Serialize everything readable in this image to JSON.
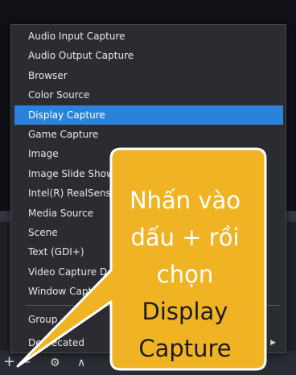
{
  "menu": {
    "items": [
      {
        "label": "Audio Input Capture"
      },
      {
        "label": "Audio Output Capture"
      },
      {
        "label": "Browser"
      },
      {
        "label": "Color Source"
      },
      {
        "label": "Display Capture",
        "selected": true
      },
      {
        "label": "Game Capture"
      },
      {
        "label": "Image"
      },
      {
        "label": "Image Slide Show"
      },
      {
        "label": "Intel(R) RealSense"
      },
      {
        "label": "Media Source"
      },
      {
        "label": "Scene"
      },
      {
        "label": "Text (GDI+)"
      },
      {
        "label": "Video Capture Device"
      },
      {
        "label": "Window Capture"
      },
      {
        "label": "Group"
      },
      {
        "label": "Deprecated",
        "has_submenu": true
      }
    ]
  },
  "toolbar": {
    "add_label": "+",
    "remove_label": "—",
    "up_label": "∧"
  },
  "callout": {
    "line1": "Nhấn vào",
    "line2": "dấu + rồi",
    "line3": "chọn",
    "line4": "Display",
    "line5": "Capture",
    "fill_color": "#f0b323",
    "border_color": "#ffffff"
  }
}
